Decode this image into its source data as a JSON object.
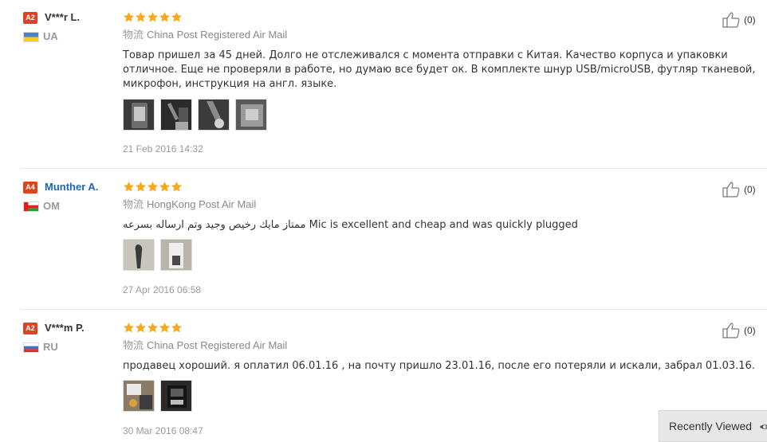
{
  "colors": {
    "accent": "#e0441f",
    "star": "#f7a91c",
    "link": "#1c64b6"
  },
  "reviews": [
    {
      "level": "A2",
      "username": "V***r L.",
      "username_color": "#333333",
      "country": "UA",
      "flag": "ukraine-flag",
      "rating": 5,
      "logistics_label": "物流",
      "logistics": "China Post Registered Air Mail",
      "text": "Товар пришел за 45 дней. Долго не отслеживался с момента отправки с Китая. Качество корпуса и упаковки отличное. Еще не проверяли в работе, но думаю все будет ок. В комплекте шнур USB/microUSB, футляр тканевой, микрофон, инструкция на англ. языке.",
      "photo_count": 4,
      "date": "21 Feb 2016 14:32",
      "helpful": "(0)"
    },
    {
      "level": "A4",
      "username": "Munther A.",
      "username_color": "#1c64b6",
      "country": "OM",
      "flag": "oman-flag",
      "rating": 5,
      "logistics_label": "物流",
      "logistics": "HongKong Post Air Mail",
      "text": "ممتاز مايك رخيص وجيد وتم ارساله بسرعه Mic is excellent and cheap and was quickly plugged",
      "photo_count": 2,
      "date": "27 Apr 2016 06:58",
      "helpful": "(0)"
    },
    {
      "level": "A2",
      "username": "V***m P.",
      "username_color": "#333333",
      "country": "RU",
      "flag": "russia-flag",
      "rating": 5,
      "logistics_label": "物流",
      "logistics": "China Post Registered Air Mail",
      "text": "продавец хороший. я оплатил 06.01.16 , на почту пришло 23.01.16, после его потеряли и искали, забрал 01.03.16.",
      "photo_count": 2,
      "date": "30 Mar 2016 08:47",
      "helpful": "(0)"
    }
  ],
  "recently_viewed": {
    "label": "Recently Viewed",
    "icon": "eye-icon"
  }
}
